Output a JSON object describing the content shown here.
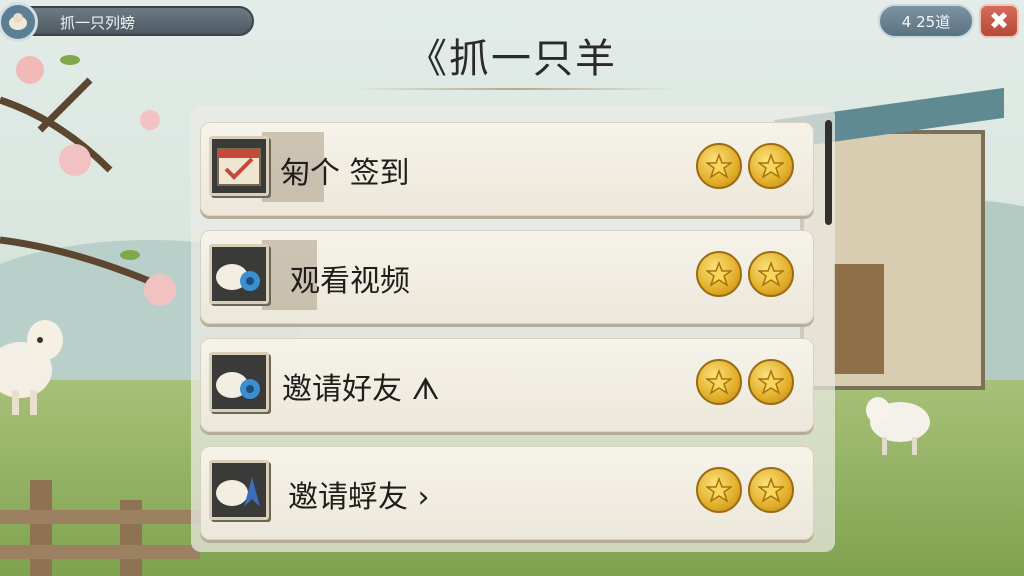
{
  "header": {
    "breadcrumb": "抓一只列螃",
    "counter": "4 25道",
    "close_label": "✖"
  },
  "title": "《抓一只羊",
  "tasks": [
    {
      "label": "匊个 签到",
      "icon": "calendar-check-icon",
      "rewards": 2
    },
    {
      "label": "观看视频",
      "icon": "sheep-gear-icon",
      "rewards": 2
    },
    {
      "label": "邀请好友 ᗑ",
      "icon": "sheep-gear-icon",
      "rewards": 2
    },
    {
      "label": "邀请蜉友 ›",
      "icon": "sheep-arrow-icon",
      "rewards": 2
    }
  ],
  "colors": {
    "coin": "#e2ae2a",
    "close": "#c85a4a",
    "counter": "#6a8292"
  }
}
